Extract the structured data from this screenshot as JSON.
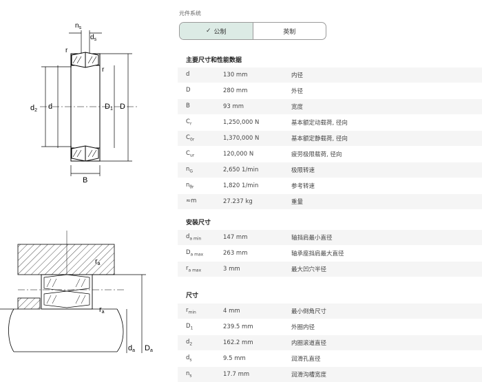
{
  "unit_system": {
    "label": "元件系统",
    "options": [
      {
        "label": "公制",
        "active": true
      },
      {
        "label": "英制",
        "active": false
      }
    ],
    "check_icon": "✓"
  },
  "drawing_top": {
    "labels": {
      "ns": "n",
      "ns_sub": "s",
      "ds": "d",
      "ds_sub": "s",
      "r1": "r",
      "r2": "r",
      "d2": "d",
      "d2_sub": "2",
      "d": "d",
      "D1": "D",
      "D1_sub": "1",
      "D": "D",
      "B": "B"
    }
  },
  "drawing_bottom": {
    "labels": {
      "ra1": "r",
      "ra1_sub": "a",
      "ra2": "r",
      "ra2_sub": "a",
      "da": "d",
      "da_sub": "a",
      "Da": "D",
      "Da_sub": "a"
    }
  },
  "sections": [
    {
      "title": "主要尺寸和性能数据",
      "rows": [
        {
          "sym": "d",
          "sub": "",
          "value": "130 mm",
          "desc": "内径"
        },
        {
          "sym": "D",
          "sub": "",
          "value": "280 mm",
          "desc": "外径"
        },
        {
          "sym": "B",
          "sub": "",
          "value": "93 mm",
          "desc": "宽度"
        },
        {
          "sym": "C",
          "sub": "r",
          "value": "1,250,000 N",
          "desc": "基本额定动载荷, 径向"
        },
        {
          "sym": "C",
          "sub": "0r",
          "value": "1,370,000 N",
          "desc": "基本额定静载荷, 径向"
        },
        {
          "sym": "C",
          "sub": "ur",
          "value": "120,000 N",
          "desc": "疲劳极限载荷, 径向"
        },
        {
          "sym": "n",
          "sub": "G",
          "value": "2,650 1/min",
          "desc": "极限转速"
        },
        {
          "sym": "n",
          "sub": "θr",
          "value": "1,820 1/min",
          "desc": "参考转速"
        },
        {
          "sym": "≈m",
          "sub": "",
          "value": "27.237 kg",
          "desc": "重量"
        }
      ]
    },
    {
      "title": "安装尺寸",
      "rows": [
        {
          "sym": "d",
          "sub": "a min",
          "value": "147 mm",
          "desc": "轴挡肩最小直径"
        },
        {
          "sym": "D",
          "sub": "a max",
          "value": "263 mm",
          "desc": "轴承座挡肩最大直径"
        },
        {
          "sym": "r",
          "sub": "a max",
          "value": "3 mm",
          "desc": "最大凹穴半径"
        }
      ]
    },
    {
      "title": "尺寸",
      "rows": [
        {
          "sym": "r",
          "sub": "min",
          "value": "4 mm",
          "desc": "最小倒角尺寸"
        },
        {
          "sym": "D",
          "sub": "1",
          "value": "239.5 mm",
          "desc": "外圈内径"
        },
        {
          "sym": "d",
          "sub": "2",
          "value": "162.2 mm",
          "desc": "内圈滚道直径"
        },
        {
          "sym": "d",
          "sub": "s",
          "value": "9.5 mm",
          "desc": "润滑孔直径"
        },
        {
          "sym": "n",
          "sub": "s",
          "value": "17.7 mm",
          "desc": "润滑沟槽宽度"
        }
      ]
    }
  ]
}
